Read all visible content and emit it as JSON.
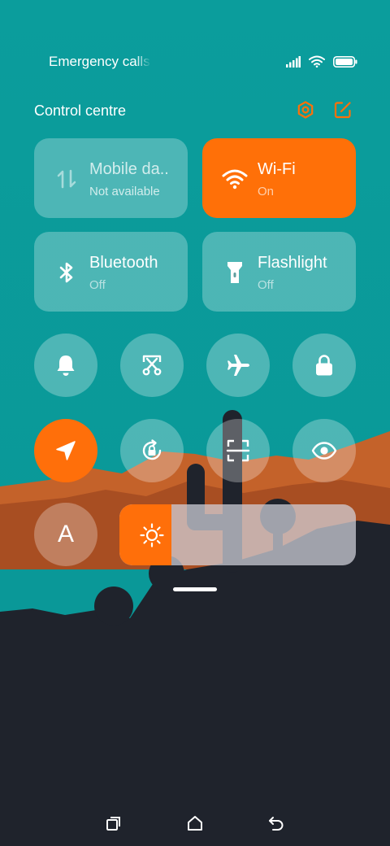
{
  "status_bar": {
    "carrier_text": "Emergency calls",
    "icons": [
      "signal-icon",
      "wifi-icon",
      "battery-icon"
    ]
  },
  "control_centre": {
    "title": "Control centre",
    "header_icons": [
      "settings-icon",
      "edit-icon"
    ]
  },
  "tiles": {
    "mobile_data": {
      "label": "Mobile da..",
      "state": "Not available",
      "icon": "mobile-data-icon"
    },
    "wifi": {
      "label": "Wi-Fi",
      "state": "On",
      "icon": "wifi-icon"
    },
    "bluetooth": {
      "label": "Bluetooth",
      "state": "Off",
      "icon": "bluetooth-icon"
    },
    "flashlight": {
      "label": "Flashlight",
      "state": "Off",
      "icon": "flashlight-icon"
    }
  },
  "toggles": {
    "row1": [
      "bell-icon",
      "screenshot-icon",
      "airplane-icon",
      "lock-icon"
    ],
    "row2": [
      "location-icon",
      "rotation-lock-icon",
      "scanner-icon",
      "eye-icon"
    ],
    "row3_letter": "A"
  },
  "brightness": {
    "level": 0.22,
    "icon": "sun-icon"
  },
  "colors": {
    "accent": "#ff7008",
    "tile_bg": "rgba(255,255,255,0.27)",
    "wallpaper_teal": "#0a9a9a",
    "wallpaper_orange": "#b85a22",
    "wallpaper_dark": "#1f232c"
  },
  "navbar": {
    "icons": [
      "recents-icon",
      "home-icon",
      "back-icon"
    ]
  }
}
